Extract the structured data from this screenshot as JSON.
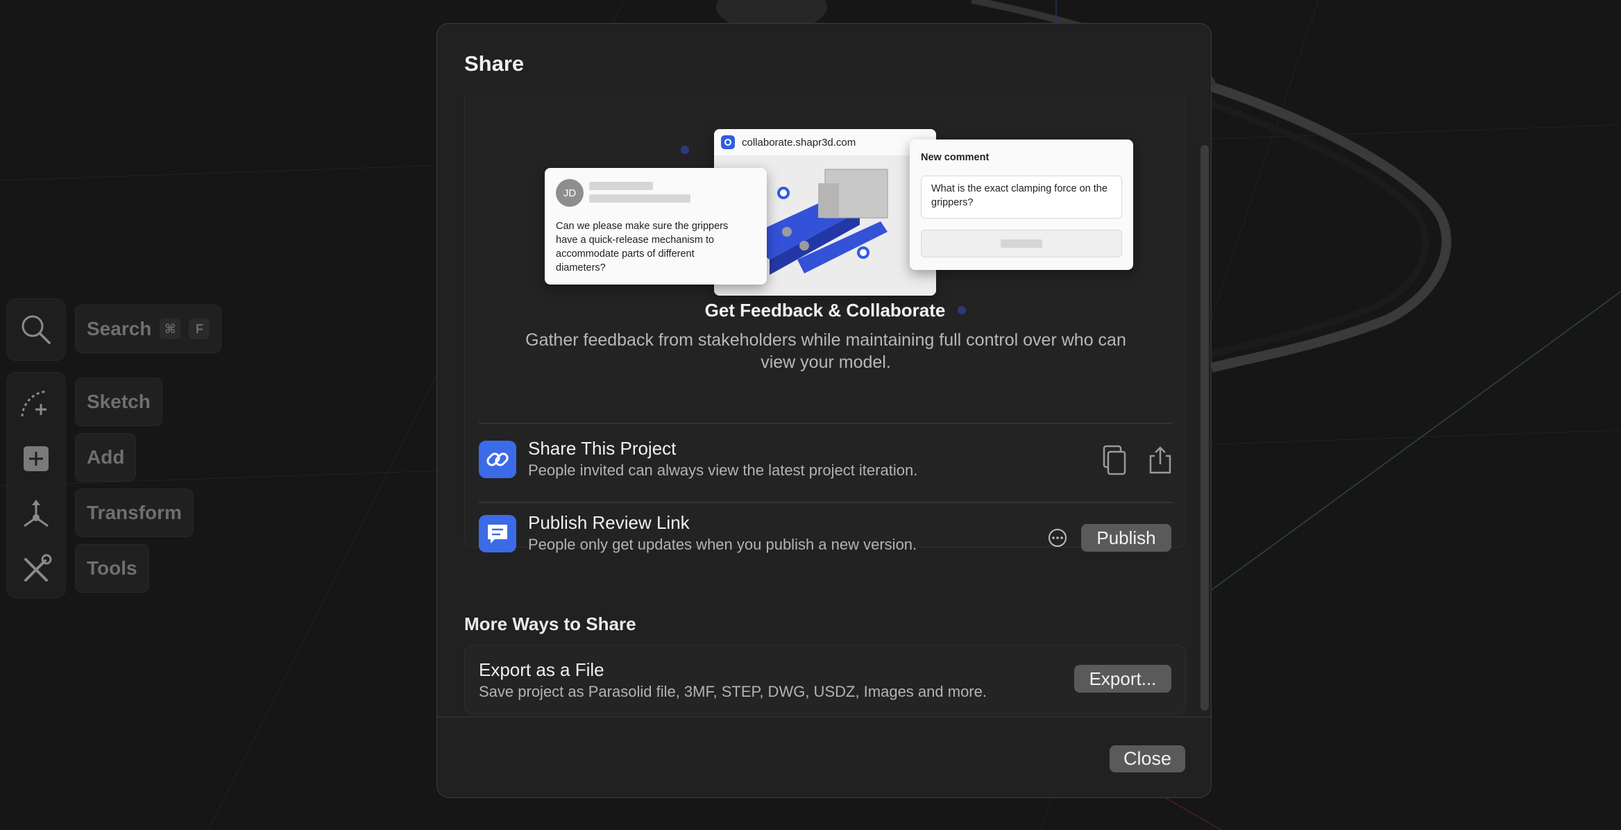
{
  "toolbar": {
    "search_label": "Search",
    "search_key_cmd": "⌘",
    "search_key": "F",
    "sketch_label": "Sketch",
    "add_label": "Add",
    "transform_label": "Transform",
    "tools_label": "Tools"
  },
  "modal": {
    "title": "Share",
    "illustration": {
      "browser_url": "collaborate.shapr3d.com",
      "avatar_initials": "JD",
      "chat_message": "Can we please make sure the grippers have a quick-release mechanism to accommodate parts of different diameters?",
      "comment_title": "New comment",
      "comment_text": "What is the exact clamping force on the grippers?"
    },
    "collaborate": {
      "title": "Get Feedback & Collaborate",
      "description": "Gather feedback from stakeholders while maintaining full control over who can view your model."
    },
    "share_project": {
      "title": "Share This Project",
      "description": "People invited can always view the latest project iteration.",
      "icon": "link-icon"
    },
    "publish_review": {
      "title": "Publish Review Link",
      "description": "People only get updates when you publish a new version.",
      "button_label": "Publish",
      "icon": "comment-icon"
    },
    "more_ways_title": "More Ways to Share",
    "export": {
      "title": "Export as a File",
      "description": "Save project as Parasolid file, 3MF, STEP, DWG, USDZ, Images and more.",
      "button_label": "Export..."
    },
    "close_label": "Close"
  },
  "colors": {
    "accent_blue": "#3c6be8",
    "button_gray": "#5a5a5a",
    "modal_bg": "#212121"
  }
}
